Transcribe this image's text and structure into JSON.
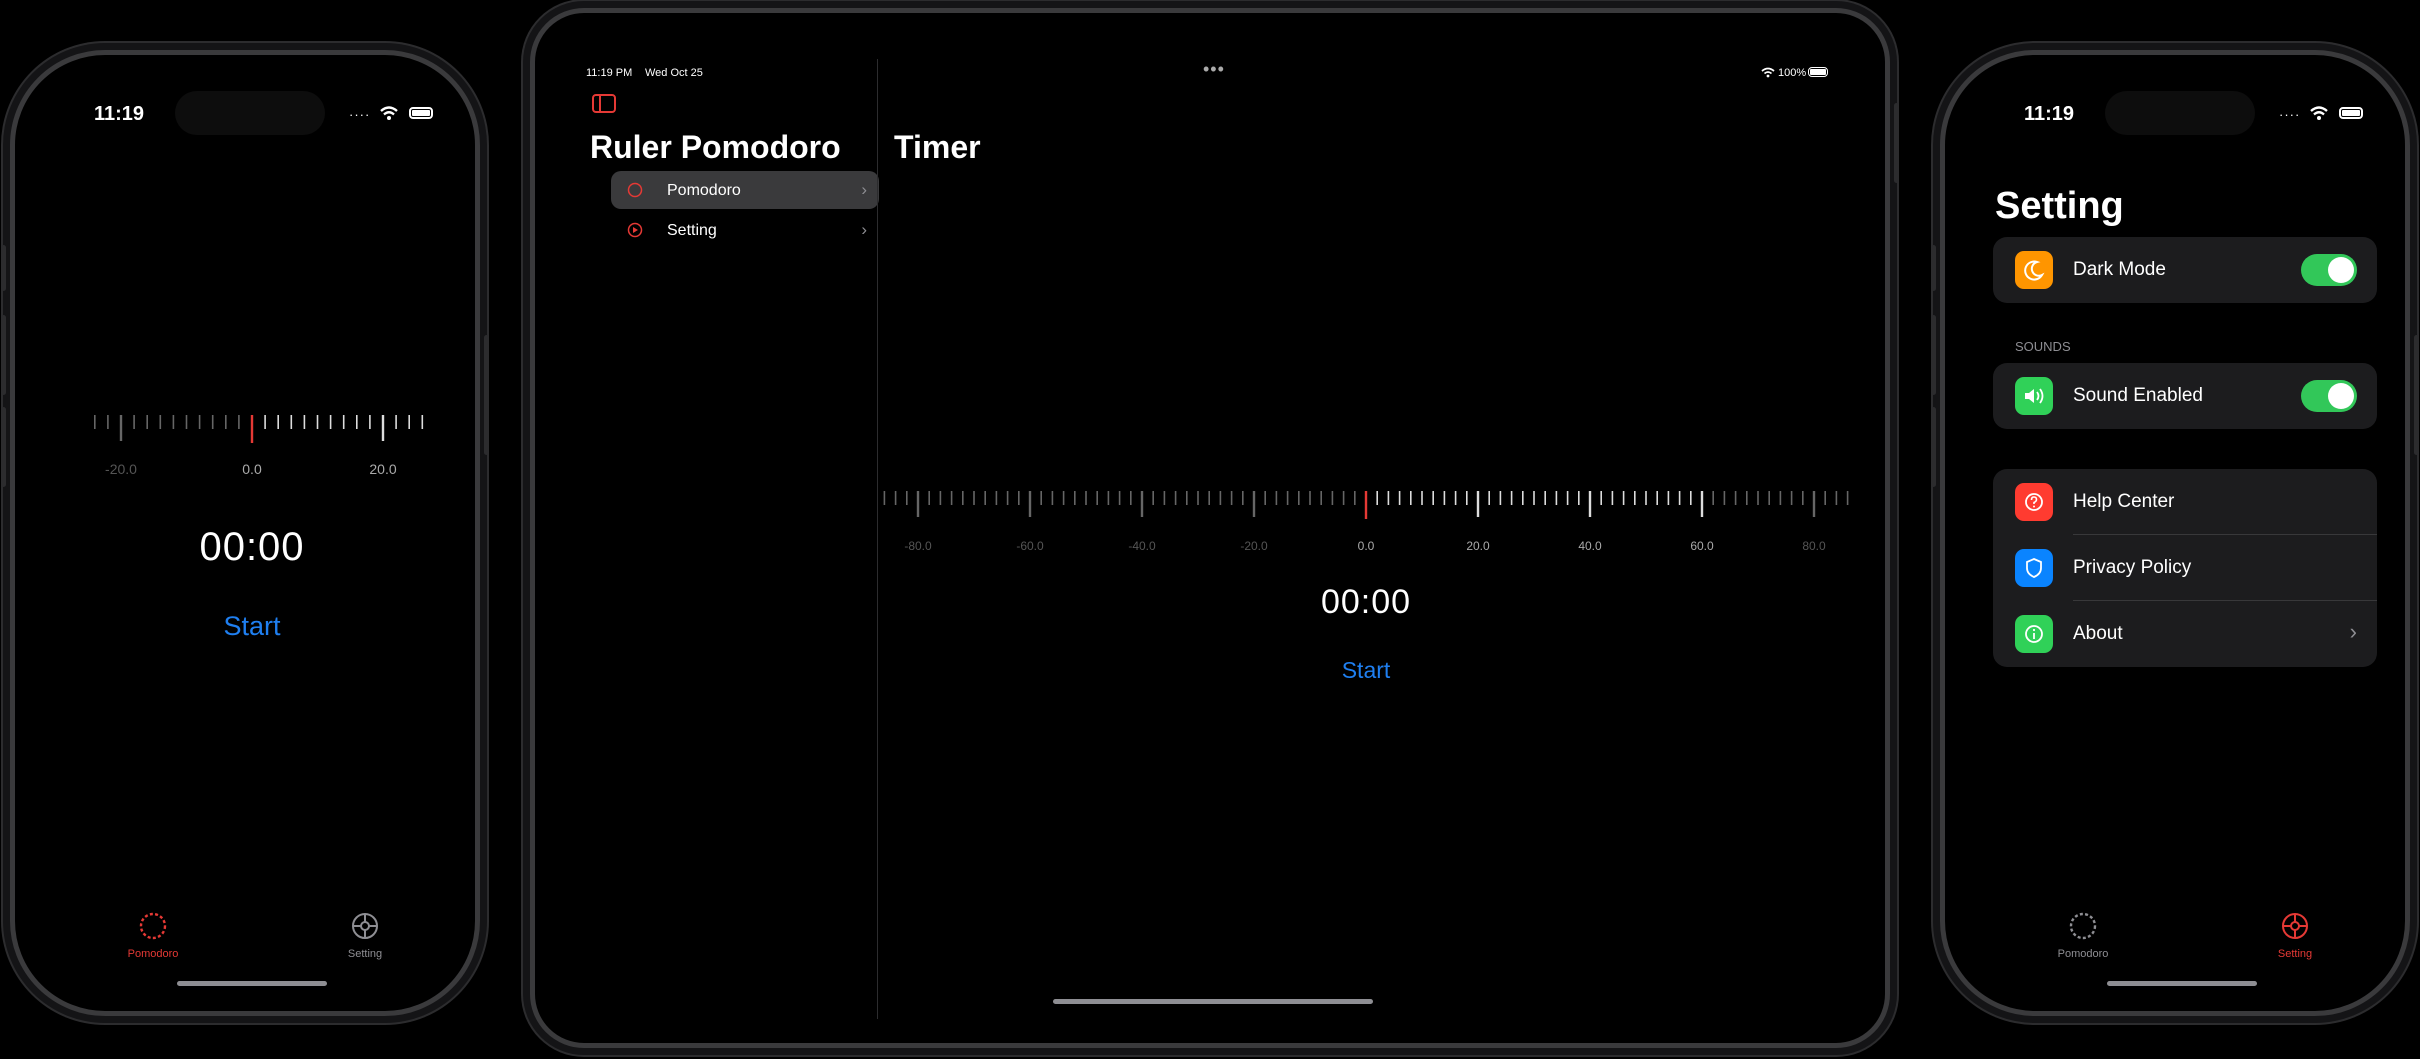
{
  "colors": {
    "accent": "#e53935",
    "link": "#1f7ff0",
    "toggle_on": "#32c759",
    "inactive": "#8e8e93"
  },
  "phone_left": {
    "status_time": "11:19",
    "ruler_labels": [
      "-20.0",
      "0.0",
      "20.0"
    ],
    "timer": "00:00",
    "start_label": "Start",
    "tabs": [
      {
        "label": "Pomodoro",
        "icon": "pomodoro-icon",
        "active": true
      },
      {
        "label": "Setting",
        "icon": "setting-icon",
        "active": false
      }
    ]
  },
  "tablet": {
    "status_time": "11:19 PM",
    "status_date": "Wed Oct 25",
    "battery": "100%",
    "sidebar_title": "Ruler Pomodoro",
    "sidebar_items": [
      {
        "label": "Pomodoro",
        "icon": "pomodoro-icon",
        "selected": true
      },
      {
        "label": "Setting",
        "icon": "setting-icon",
        "selected": false
      }
    ],
    "detail_title": "Timer",
    "ruler_labels": [
      "-80.0",
      "-60.0",
      "-40.0",
      "-20.0",
      "0.0",
      "20.0",
      "40.0",
      "60.0",
      "80.0"
    ],
    "timer": "00:00",
    "start_label": "Start"
  },
  "phone_right": {
    "status_time": "11:19",
    "title": "Setting",
    "dark_mode": {
      "label": "Dark Mode",
      "on": true,
      "icon": "moon-icon"
    },
    "sounds_header": "SOUNDS",
    "sound_enabled": {
      "label": "Sound Enabled",
      "on": true,
      "icon": "speaker-icon"
    },
    "links": [
      {
        "label": "Help Center",
        "icon": "question-icon",
        "color": "#ff3b30"
      },
      {
        "label": "Privacy Policy",
        "icon": "shield-icon",
        "color": "#0a84ff"
      },
      {
        "label": "About",
        "icon": "info-icon",
        "color": "#30d158"
      }
    ],
    "tabs": [
      {
        "label": "Pomodoro",
        "icon": "pomodoro-icon",
        "active": false
      },
      {
        "label": "Setting",
        "icon": "setting-icon",
        "active": true
      }
    ]
  }
}
